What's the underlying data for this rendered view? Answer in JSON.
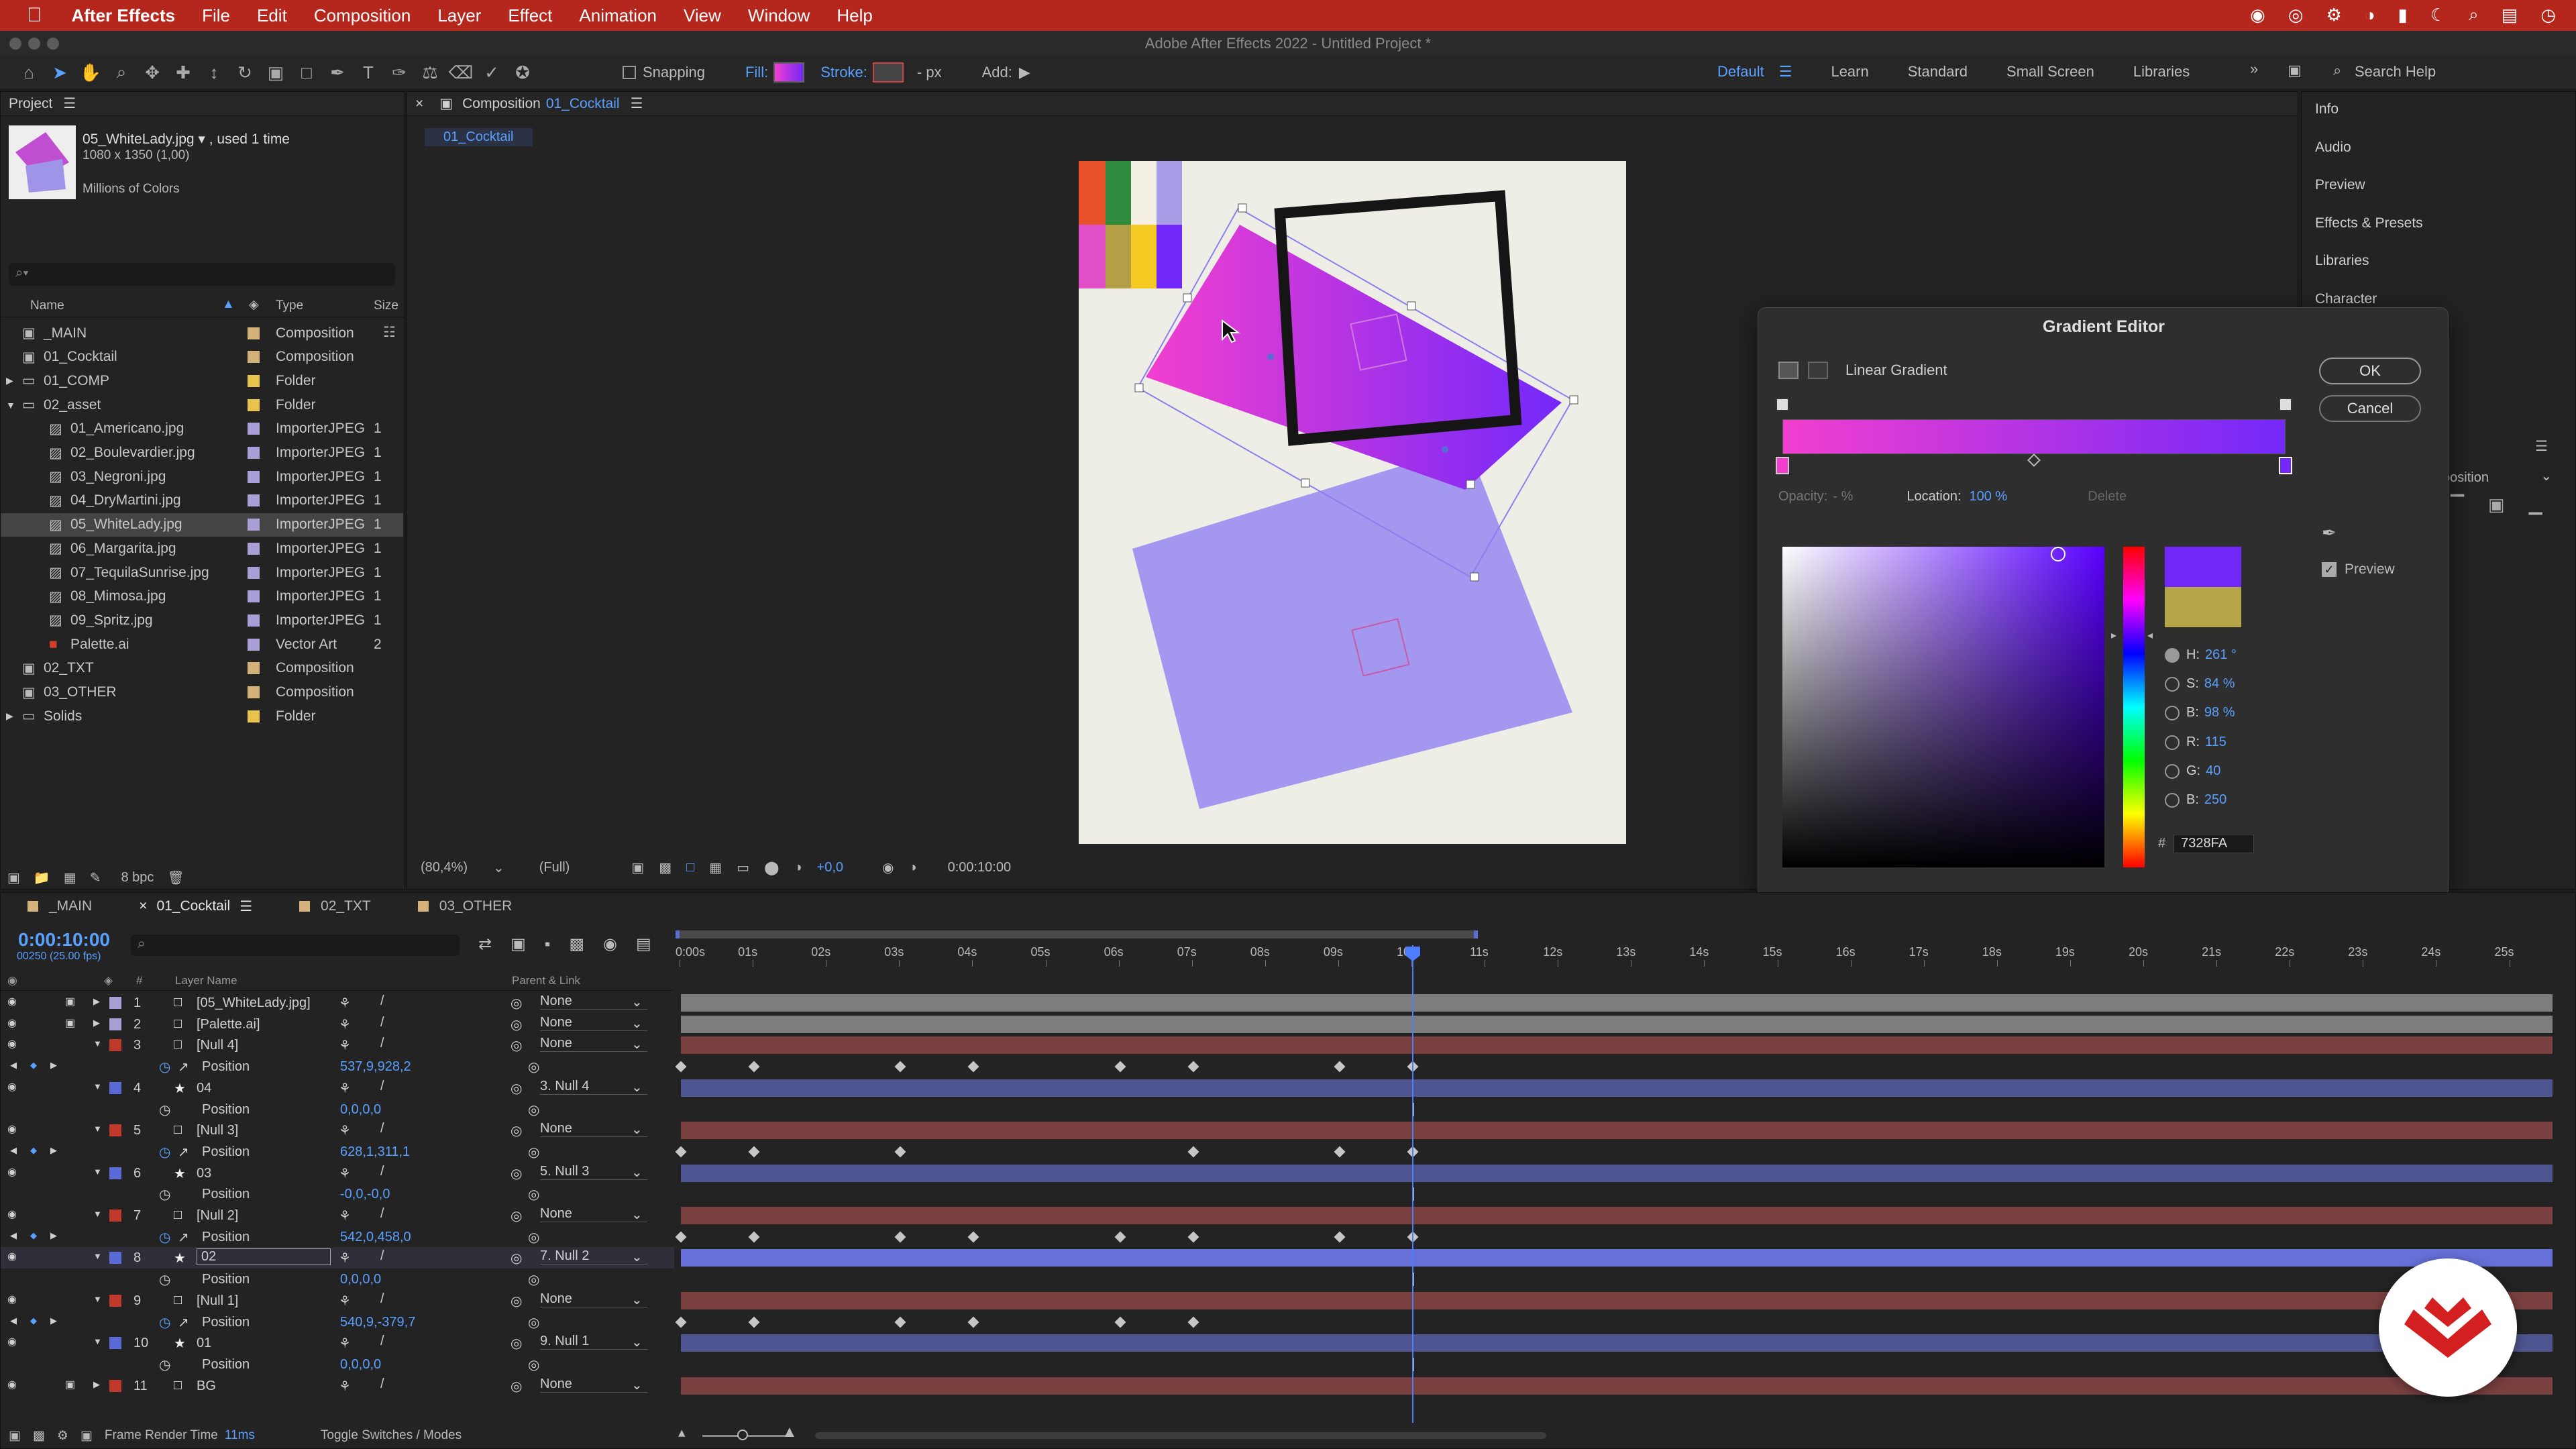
{
  "menubar": {
    "app": "After Effects",
    "items": [
      "File",
      "Edit",
      "Composition",
      "Layer",
      "Effect",
      "Animation",
      "View",
      "Window",
      "Help"
    ]
  },
  "titlebar": {
    "title": "Adobe After Effects 2022 - Untitled Project *"
  },
  "toolbar": {
    "snapping": "Snapping",
    "fill": "Fill:",
    "stroke": "Stroke:",
    "stroke_px": "- px",
    "add": "Add:",
    "workspaces": [
      "Default",
      "Learn",
      "Standard",
      "Small Screen",
      "Libraries"
    ],
    "search_placeholder": "Search Help"
  },
  "project": {
    "title": "Project",
    "selected_name": "05_WhiteLady.jpg ▾ , used 1 time",
    "selected_dims": "1080 x 1350 (1,00)",
    "selected_colors": "Millions of Colors",
    "search_placeholder": "⌕▾",
    "columns": {
      "name": "Name",
      "type": "Type",
      "size": "Size"
    },
    "bpc": "8 bpc",
    "items": [
      {
        "name": "_MAIN",
        "type": "Composition",
        "used": "",
        "color": "#d4b27a",
        "indent": 0,
        "kind": "comp"
      },
      {
        "name": "01_Cocktail",
        "type": "Composition",
        "used": "",
        "color": "#d4b27a",
        "indent": 0,
        "kind": "comp"
      },
      {
        "name": "01_COMP",
        "type": "Folder",
        "used": "",
        "color": "#e8c44a",
        "indent": 0,
        "kind": "folder"
      },
      {
        "name": "02_asset",
        "type": "Folder",
        "used": "",
        "color": "#e8c44a",
        "indent": 0,
        "kind": "folder"
      },
      {
        "name": "01_Americano.jpg",
        "type": "ImporterJPEG",
        "used": "1",
        "color": "#a99fd6",
        "indent": 1,
        "kind": "file"
      },
      {
        "name": "02_Boulevardier.jpg",
        "type": "ImporterJPEG",
        "used": "1",
        "color": "#a99fd6",
        "indent": 1,
        "kind": "file"
      },
      {
        "name": "03_Negroni.jpg",
        "type": "ImporterJPEG",
        "used": "1",
        "color": "#a99fd6",
        "indent": 1,
        "kind": "file"
      },
      {
        "name": "04_DryMartini.jpg",
        "type": "ImporterJPEG",
        "used": "1",
        "color": "#a99fd6",
        "indent": 1,
        "kind": "file"
      },
      {
        "name": "05_WhiteLady.jpg",
        "type": "ImporterJPEG",
        "used": "1",
        "color": "#a99fd6",
        "indent": 1,
        "kind": "file"
      },
      {
        "name": "06_Margarita.jpg",
        "type": "ImporterJPEG",
        "used": "1",
        "color": "#a99fd6",
        "indent": 1,
        "kind": "file"
      },
      {
        "name": "07_TequilaSunrise.jpg",
        "type": "ImporterJPEG",
        "used": "1",
        "color": "#a99fd6",
        "indent": 1,
        "kind": "file"
      },
      {
        "name": "08_Mimosa.jpg",
        "type": "ImporterJPEG",
        "used": "1",
        "color": "#a99fd6",
        "indent": 1,
        "kind": "file"
      },
      {
        "name": "09_Spritz.jpg",
        "type": "ImporterJPEG",
        "used": "1",
        "color": "#a99fd6",
        "indent": 1,
        "kind": "file"
      },
      {
        "name": "Palette.ai",
        "type": "Vector Art",
        "used": "2",
        "color": "#a99fd6",
        "indent": 1,
        "kind": "ai"
      },
      {
        "name": "02_TXT",
        "type": "Composition",
        "used": "",
        "color": "#d4b27a",
        "indent": 0,
        "kind": "comp"
      },
      {
        "name": "03_OTHER",
        "type": "Composition",
        "used": "",
        "color": "#d4b27a",
        "indent": 0,
        "kind": "comp"
      },
      {
        "name": "Solids",
        "type": "Folder",
        "used": "",
        "color": "#e8c44a",
        "indent": 0,
        "kind": "folder"
      }
    ]
  },
  "composition": {
    "tab_label": "Composition",
    "comp_name": "01_Cocktail",
    "breadcrumb": "01_Cocktail",
    "zoom": "(80,4%)",
    "resolution": "(Full)",
    "exposure": "+0,0",
    "timecode": "0:00:10:00"
  },
  "gradient_editor": {
    "title": "Gradient Editor",
    "type_label": "Linear Gradient",
    "ok": "OK",
    "cancel": "Cancel",
    "opacity_label": "Opacity:",
    "opacity_value": "- %",
    "location_label": "Location:",
    "location_value": "100 %",
    "delete": "Delete",
    "preview_label": "Preview",
    "h_label": "H:",
    "h_value": "261 °",
    "s_label": "S:",
    "s_value": "84 %",
    "b_label": "B:",
    "b_value": "98 %",
    "r_label": "R:",
    "r_value": "115",
    "g_label": "G:",
    "g_value": "40",
    "bl_label": "B:",
    "bl_value": "250",
    "hex_label": "#",
    "hex_value": "7328FA",
    "new_color": "#7328fa",
    "old_color": "#b5a448",
    "gradient_start": "#f23fcf",
    "gradient_end": "#7328fa"
  },
  "right_panel": {
    "items": [
      "Info",
      "Audio",
      "Preview",
      "Effects & Presets",
      "Libraries",
      "Character"
    ],
    "align_label": "position"
  },
  "timeline": {
    "tabs": [
      "_MAIN",
      "01_Cocktail",
      "02_TXT",
      "03_OTHER"
    ],
    "timecode": "0:00:10:00",
    "frame_info": "00250 (25.00 fps)",
    "col_layer_name": "Layer Name",
    "col_parent": "Parent & Link",
    "ruler": [
      "0:00s",
      "01s",
      "02s",
      "03s",
      "04s",
      "05s",
      "06s",
      "07s",
      "08s",
      "09s",
      "10s",
      "11s",
      "12s",
      "13s",
      "14s",
      "15s",
      "16s",
      "17s",
      "18s",
      "19s",
      "20s",
      "21s",
      "22s",
      "23s",
      "24s",
      "25s"
    ],
    "frame_render_label": "Frame Render Time",
    "frame_render_value": "11ms",
    "toggle_label": "Toggle Switches / Modes",
    "layers": [
      {
        "num": "1",
        "name": "[05_WhiteLady.jpg]",
        "parent": "None",
        "color": "#a99fd6",
        "kind": "layer",
        "track": "gray"
      },
      {
        "num": "2",
        "name": "[Palette.ai]",
        "parent": "None",
        "color": "#a99fd6",
        "kind": "layer",
        "track": "gray"
      },
      {
        "num": "3",
        "name": "[Null 4]",
        "parent": "None",
        "color": "#c0392b",
        "kind": "layer",
        "track": "red"
      },
      {
        "num": "",
        "name": "Position",
        "value": "537,9,928,2",
        "kind": "prop",
        "keys": [
          0,
          1,
          3,
          4,
          6,
          7,
          9,
          10
        ]
      },
      {
        "num": "4",
        "name": "04",
        "parent": "3. Null 4",
        "color": "#5a6bd8",
        "kind": "layer",
        "track": "blue"
      },
      {
        "num": "",
        "name": "Position",
        "value": "0,0,0,0",
        "kind": "prop",
        "keys": []
      },
      {
        "num": "5",
        "name": "[Null 3]",
        "parent": "None",
        "color": "#c0392b",
        "kind": "layer",
        "track": "red"
      },
      {
        "num": "",
        "name": "Position",
        "value": "628,1,311,1",
        "kind": "prop",
        "keys": [
          0,
          1,
          3,
          7,
          9,
          10
        ]
      },
      {
        "num": "6",
        "name": "03",
        "parent": "5. Null 3",
        "color": "#5a6bd8",
        "kind": "layer",
        "track": "blue"
      },
      {
        "num": "",
        "name": "Position",
        "value": "-0,0,-0,0",
        "kind": "prop",
        "keys": []
      },
      {
        "num": "7",
        "name": "[Null 2]",
        "parent": "None",
        "color": "#c0392b",
        "kind": "layer",
        "track": "red"
      },
      {
        "num": "",
        "name": "Position",
        "value": "542,0,458,0",
        "kind": "prop",
        "keys": [
          0,
          1,
          3,
          4,
          6,
          7,
          9,
          10
        ]
      },
      {
        "num": "8",
        "name": "02",
        "parent": "7. Null 2",
        "color": "#5a6bd8",
        "kind": "layer",
        "track": "bluesel"
      },
      {
        "num": "",
        "name": "Position",
        "value": "0,0,0,0",
        "kind": "prop",
        "keys": []
      },
      {
        "num": "9",
        "name": "[Null 1]",
        "parent": "None",
        "color": "#c0392b",
        "kind": "layer",
        "track": "red"
      },
      {
        "num": "",
        "name": "Position",
        "value": "540,9,-379,7",
        "kind": "prop",
        "keys": [
          0,
          1,
          3,
          4,
          6,
          7
        ]
      },
      {
        "num": "10",
        "name": "01",
        "parent": "9. Null 1",
        "color": "#5a6bd8",
        "kind": "layer",
        "track": "blue"
      },
      {
        "num": "",
        "name": "Position",
        "value": "0,0,0,0",
        "kind": "prop",
        "keys": []
      },
      {
        "num": "11",
        "name": "BG",
        "parent": "None",
        "color": "#c0392b",
        "kind": "layer",
        "track": "red"
      }
    ]
  }
}
